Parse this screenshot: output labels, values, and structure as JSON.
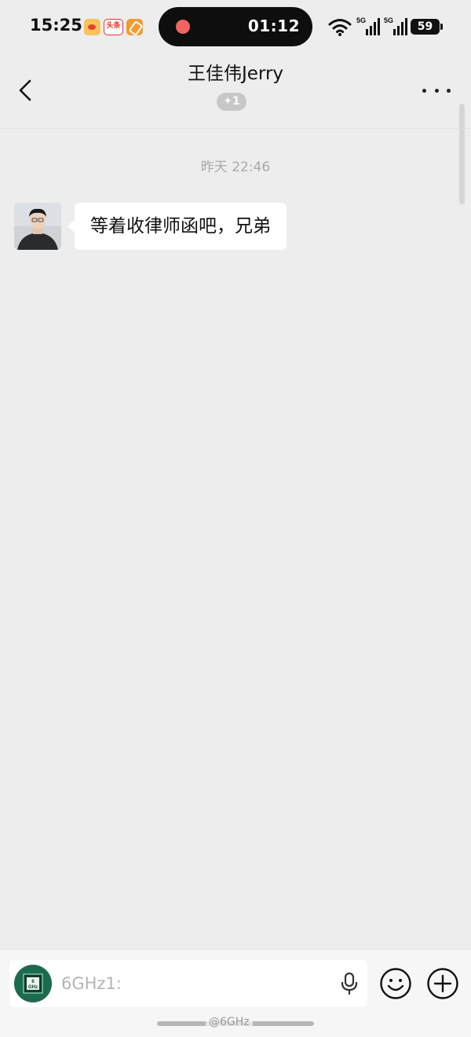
{
  "status_bar": {
    "time": "15:25",
    "notification_icons": [
      "weibo-icon",
      "toutiao-icon",
      "orange-app-icon"
    ],
    "toutiao_label": "头条",
    "recording_timer": "01:12",
    "signal_labels": [
      "5G",
      "5G"
    ],
    "battery": "59"
  },
  "header": {
    "title": "王佳伟Jerry",
    "badge": "✦1",
    "back_icon": "chevron-left-icon",
    "more_icon": "more-dots-icon"
  },
  "messages": [
    {
      "timestamp": "昨天 22:46",
      "sender": "王佳伟Jerry",
      "text": "等着收律师函吧，兄弟"
    }
  ],
  "input_bar": {
    "placeholder": "6GHz1:",
    "value": "",
    "icons": [
      "microphone-icon",
      "emoji-icon",
      "plus-icon"
    ]
  },
  "watermark": "@6GHz",
  "colors": {
    "background": "#ededed",
    "bubble": "#ffffff",
    "recording_dot": "#f2645f",
    "timestamp_text": "#a9a9a9"
  }
}
